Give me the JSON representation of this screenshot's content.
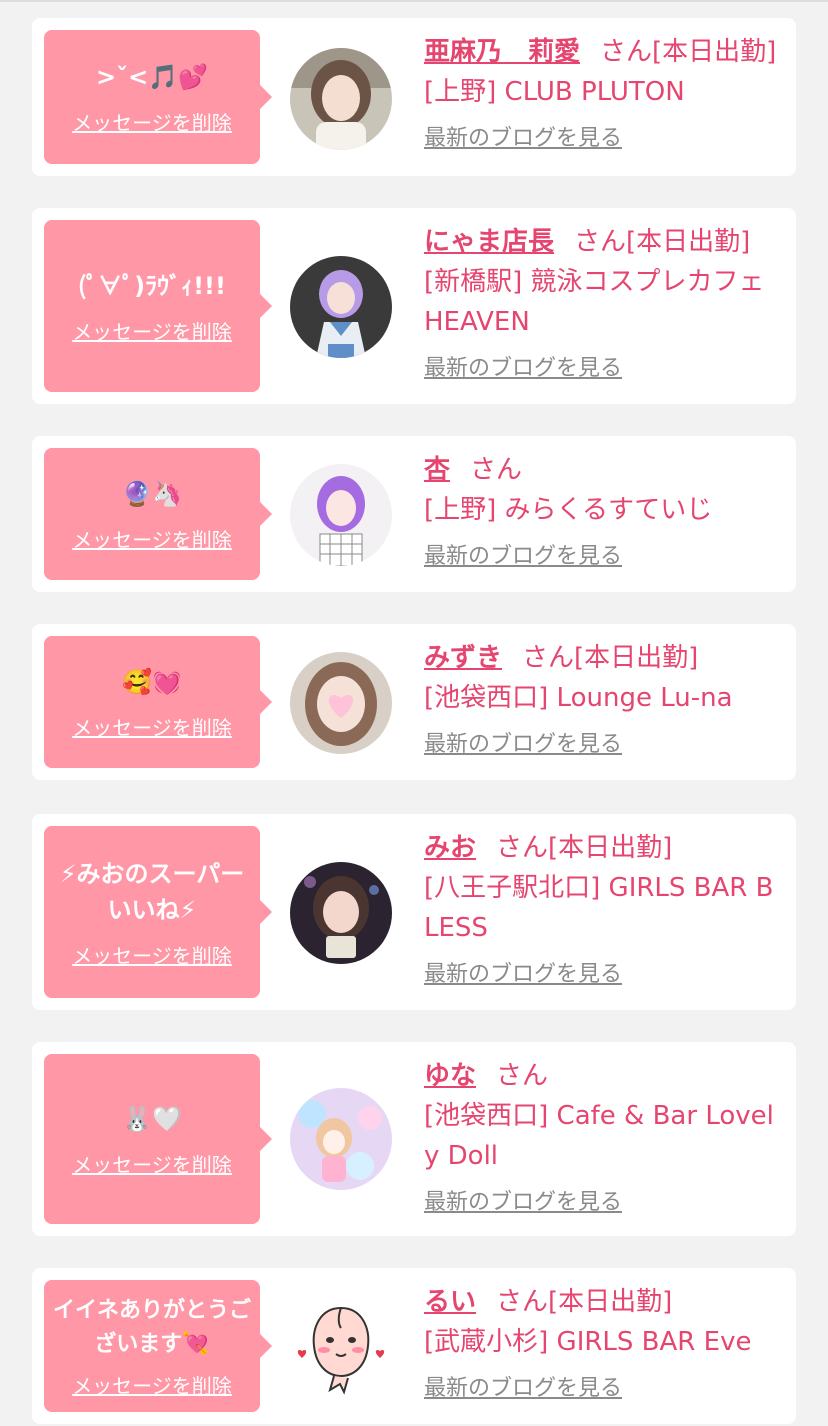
{
  "common": {
    "delete_label": "メッセージを削除",
    "blog_label": "最新のブログを見る"
  },
  "colors": {
    "page_bg": "#f2f2f2",
    "bubble": "#ff97a6",
    "name_pink": "#e5456f",
    "blog_gray": "#8a8a8a"
  },
  "entries": [
    {
      "message": ">ˇ<🎵💕",
      "name": "亜麻乃　莉愛",
      "suffix": "さん[本日出勤]",
      "shop": "[上野] CLUB PLUTON",
      "avatar_icon": "avatar-woman-light-hair"
    },
    {
      "message": "(ﾟ∀ﾟ)ﾗｳﾞｨ!!!",
      "name": "にゃま店長",
      "suffix": "さん[本日出勤]",
      "shop": "[新橋駅] 競泳コスプレカフェ　HEAVEN",
      "avatar_icon": "avatar-cosplay-purple-hair"
    },
    {
      "message": "🔮🦄",
      "name": "杏",
      "suffix": "さん",
      "shop": "[上野] みらくるすていじ",
      "avatar_icon": "avatar-purple-hair"
    },
    {
      "message": "🥰💓",
      "name": "みずき",
      "suffix": "さん[本日出勤]",
      "shop": "[池袋西口] Lounge Lu-na",
      "avatar_icon": "avatar-heart-face"
    },
    {
      "message": "⚡みおのスーパーいいね⚡",
      "name": "みお",
      "suffix": "さん[本日出勤]",
      "shop": "[八王子駅北口] GIRLS BAR BLESS",
      "avatar_icon": "avatar-woman-dark-hair"
    },
    {
      "message": "🐰🤍",
      "name": "ゆな",
      "suffix": "さん",
      "shop": "[池袋西口] Cafe & Bar Lovely Doll",
      "avatar_icon": "avatar-anime-illustration"
    },
    {
      "message": "イイネありがとうございます💘",
      "name": "るい",
      "suffix": "さん[本日出勤]",
      "shop": "[武蔵小杉] GIRLS BAR Eve",
      "avatar_icon": "avatar-peach-character"
    }
  ]
}
